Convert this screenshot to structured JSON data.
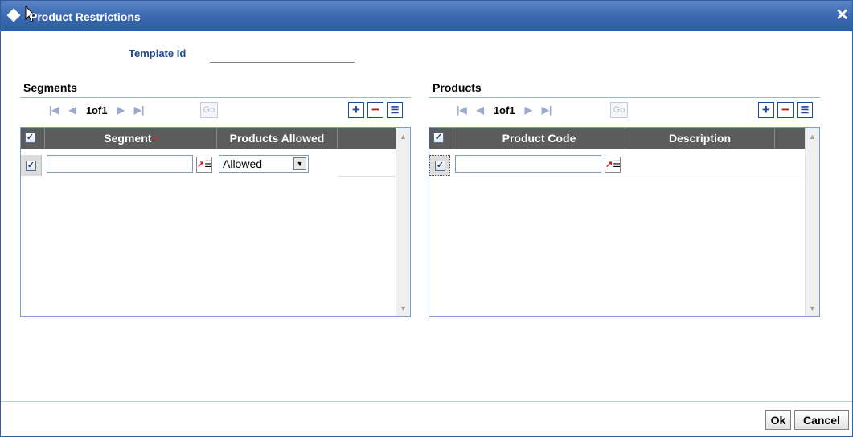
{
  "window": {
    "title": "Product Restrictions"
  },
  "template": {
    "label": "Template Id",
    "value": ""
  },
  "segments": {
    "title": "Segments",
    "pager": {
      "text": "1of1",
      "go": "Go"
    },
    "columns": [
      "Segment",
      "Products Allowed"
    ],
    "required_mark": "*",
    "rows": [
      {
        "checked": true,
        "segment": "",
        "products_allowed": "Allowed"
      }
    ]
  },
  "products": {
    "title": "Products",
    "pager": {
      "text": "1of1",
      "go": "Go"
    },
    "columns": [
      "Product Code",
      "Description"
    ],
    "rows": [
      {
        "checked": true,
        "product_code": "",
        "description": ""
      }
    ]
  },
  "buttons": {
    "ok": "Ok",
    "cancel": "Cancel"
  },
  "colors": {
    "titlebar": "#3c69b0",
    "grid_header": "#5c5c5c",
    "label_blue": "#1f4a9a"
  }
}
